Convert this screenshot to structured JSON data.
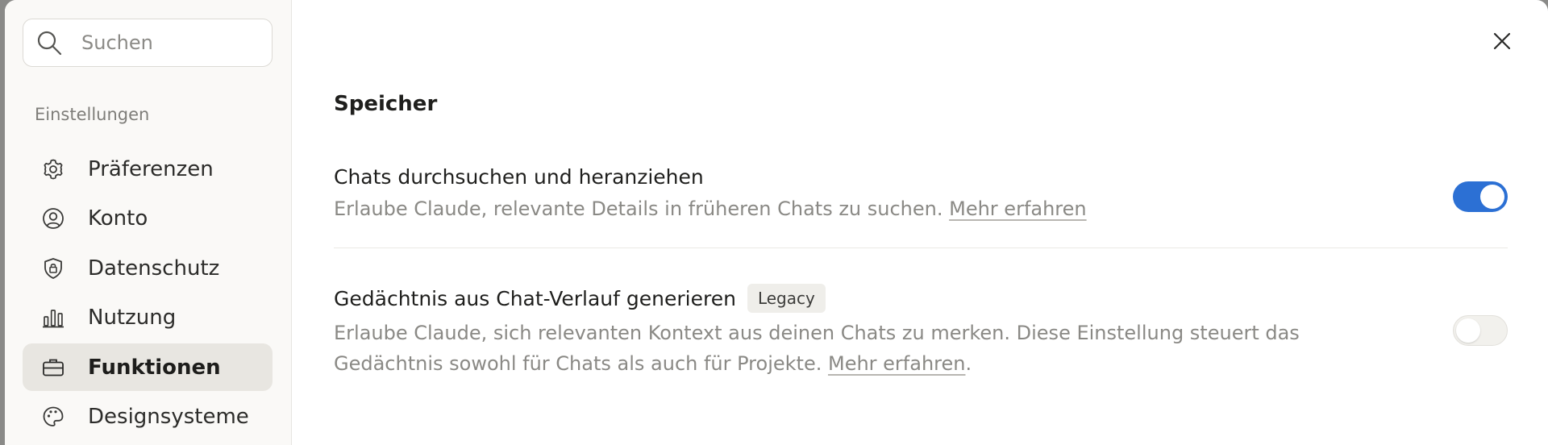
{
  "sidebar": {
    "search": {
      "placeholder": "Suchen",
      "icon": "search-icon"
    },
    "section_label": "Einstellungen",
    "items": [
      {
        "label": "Präferenzen",
        "icon": "gear-icon",
        "active": false
      },
      {
        "label": "Konto",
        "icon": "user-circle-icon",
        "active": false
      },
      {
        "label": "Datenschutz",
        "icon": "shield-lock-icon",
        "active": false
      },
      {
        "label": "Nutzung",
        "icon": "bar-chart-icon",
        "active": false
      },
      {
        "label": "Funktionen",
        "icon": "briefcase-icon",
        "active": true
      },
      {
        "label": "Designsysteme",
        "icon": "palette-icon",
        "active": false
      }
    ]
  },
  "main": {
    "heading": "Speicher",
    "settings": [
      {
        "title": "Chats durchsuchen und heranziehen",
        "description": "Erlaube Claude, relevante Details in früheren Chats zu suchen.",
        "link": "Mehr erfahren",
        "enabled": true
      },
      {
        "title": "Gedächtnis aus Chat-Verlauf generieren",
        "badge": "Legacy",
        "description": "Erlaube Claude, sich relevanten Kontext aus deinen Chats zu merken. Diese Einstellung steuert das Gedächtnis sowohl für Chats als auch für Projekte.",
        "link": "Mehr erfahren",
        "link_suffix": ".",
        "enabled": false
      }
    ]
  },
  "colors": {
    "accent": "#2c70d4",
    "sidebar_bg": "#faf9f7",
    "active_item_bg": "#e8e6e1"
  }
}
